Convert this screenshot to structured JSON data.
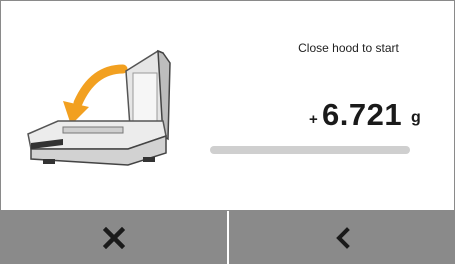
{
  "status": {
    "instruction": "Close hood to start"
  },
  "weight": {
    "sign": "+",
    "value": "6.721",
    "unit": "g"
  },
  "progress": {
    "fraction": 0.0
  },
  "buttons": {
    "cancel_icon": "close-x-icon",
    "back_icon": "chevron-left-icon"
  },
  "colors": {
    "accent": "#f2a020",
    "button_bg": "#8a8a8a",
    "panel_bg": "#ffffff",
    "progress_track": "#cfcfcf"
  }
}
